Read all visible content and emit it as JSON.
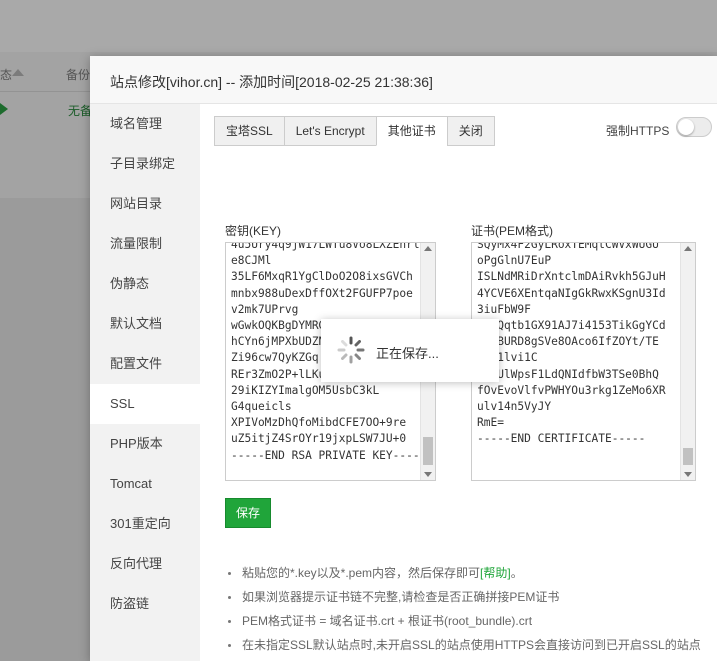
{
  "background": {
    "column_status": "态",
    "column_backup": "备份",
    "row_backup_value": "无备"
  },
  "modal": {
    "title": "站点修改[vihor.cn] -- 添加时间[2018-02-25 21:38:36]"
  },
  "sidebar": {
    "items": [
      {
        "label": "域名管理"
      },
      {
        "label": "子目录绑定"
      },
      {
        "label": "网站目录"
      },
      {
        "label": "流量限制"
      },
      {
        "label": "伪静态"
      },
      {
        "label": "默认文档"
      },
      {
        "label": "配置文件"
      },
      {
        "label": "SSL"
      },
      {
        "label": "PHP版本"
      },
      {
        "label": "Tomcat"
      },
      {
        "label": "301重定向"
      },
      {
        "label": "反向代理"
      },
      {
        "label": "防盗链"
      }
    ],
    "active_index": 7
  },
  "ssl": {
    "tabs": [
      {
        "label": "宝塔SSL"
      },
      {
        "label": "Let's Encrypt"
      },
      {
        "label": "其他证书"
      },
      {
        "label": "关闭"
      }
    ],
    "active_tab": 2,
    "force_https_label": "强制HTTPS",
    "force_https_enabled": false,
    "key_label": "密钥(KEY)",
    "cert_label": "证书(PEM格式)",
    "key_text": "4u5Ury4q9jW17LWTu8Vo8LXZEnrl\ne8CJMl\n35LF6MxqR1YgClDoO2O8ixsGVCh\nmnbx988uDexDffOXt2FGUFP7poe\nv2mk7UPrvg\nwGwkOQKBgDYMRGLzPmjPSw7cP\nhCYn6jMPXbUDZNzRhUxOXuISGH\nZi96cw7QyKZGq\nREr3ZmO2P+lLKuk6B3j8Gu2\n29iKIZYImalgOM5UsbC3kL\nG4queicls\nXPIVoMzDhQfoMibdCFE7OO+9re\nuZ5itjZ4SrOYr19jxpLSW7JU+0\n-----END RSA PRIVATE KEY-----",
    "cert_text": "SQyMx4F2GyLRoxTEMqtCWVxWUGU\noPgGlnU7EuP\nISLNdMRiDrXntclmDAiRvkh5GJuH\n4YCVE6XEntqaNIgGkRwxKSgnU3Id\n3iuFbW9F\nUQ9Qqtb1GX91AJ7i4153TikGgYCd\nwYkBURD8gSVe8OAco6IfZOYt/TE\nwii1lvi1C\n4jYUlWpsF1LdQNIdfbW3TSe0BhQ\nfOvEvoVlfvPWHYOu3rkg1ZeMo6XR\nulv14n5VyJY\nRmE=\n-----END CERTIFICATE-----",
    "save_label": "保存",
    "notes": [
      {
        "text": "粘贴您的*.key以及*.pem内容，然后保存即可",
        "link": "[帮助]",
        "suffix": "。"
      },
      {
        "text": "如果浏览器提示证书链不完整,请检查是否正确拼接PEM证书"
      },
      {
        "text": "PEM格式证书 = 域名证书.crt + 根证书(root_bundle).crt"
      },
      {
        "text": "在未指定SSL默认站点时,未开启SSL的站点使用HTTPS会直接访问到已开启SSL的站点"
      }
    ]
  },
  "loading": {
    "text": "正在保存..."
  },
  "colors": {
    "accent": "#20a53a",
    "overlay": "#9b9b9b"
  }
}
